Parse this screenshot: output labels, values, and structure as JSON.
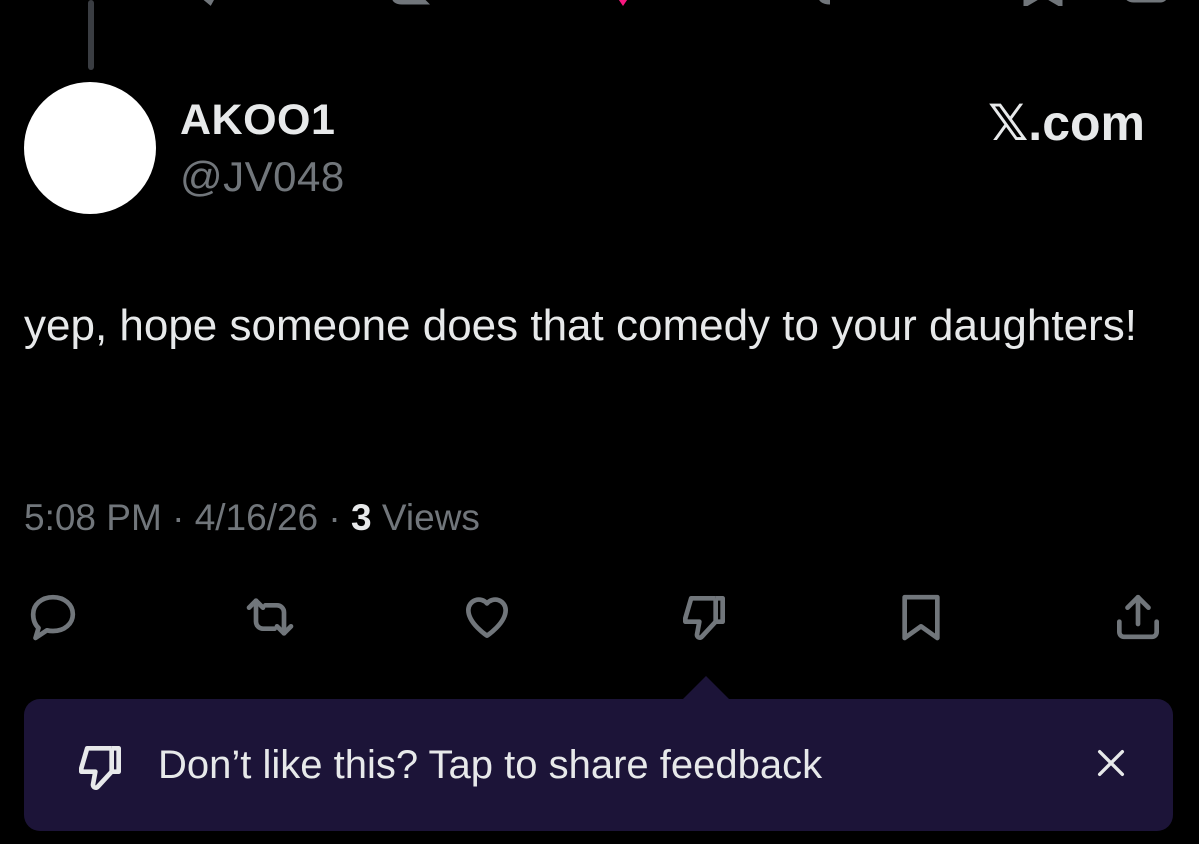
{
  "tweet": {
    "author": {
      "display_name": "AKOO1",
      "handle": "@JV048",
      "avatar_color": "#ffffff"
    },
    "brand": "𝕏.com",
    "text": "yep, hope someone does that comedy to your daughters!",
    "meta": {
      "time": "5:08 PM",
      "separator": " · ",
      "date": "4/16/26",
      "views_count": "3",
      "views_label": "Views"
    }
  },
  "actions": [
    {
      "name": "reply",
      "icon": "speech-bubble-icon"
    },
    {
      "name": "repost",
      "icon": "repost-arrows-icon"
    },
    {
      "name": "like",
      "icon": "heart-icon"
    },
    {
      "name": "dislike",
      "icon": "thumbs-down-icon"
    },
    {
      "name": "bookmark",
      "icon": "bookmark-icon"
    },
    {
      "name": "share",
      "icon": "share-upload-icon"
    }
  ],
  "feedback_toast": {
    "icon": "thumbs-down-icon",
    "text": "Don’t like this? Tap to share feedback",
    "close_icon": "close-icon",
    "background": "#1c1438"
  },
  "colors": {
    "background": "#000000",
    "primary_text": "#e7e9ea",
    "secondary_text": "#71767b",
    "icon": "#71767b",
    "top_like_accent": "#f91880"
  }
}
